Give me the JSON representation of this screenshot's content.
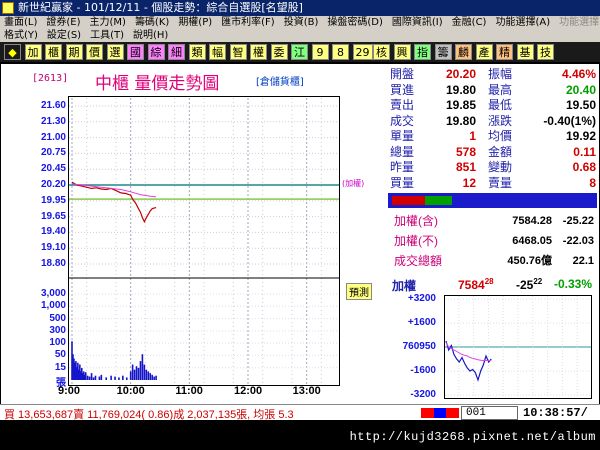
{
  "window": {
    "title": "新世紀贏家 - 101/12/11 - 個股走勢：綜合自選股[名望股]"
  },
  "menu": {
    "row1": [
      "畫面(L)",
      "證券(E)",
      "主力(M)",
      "籌碼(K)",
      "期權(P)",
      "匯市利率(F)",
      "投資(B)",
      "操盤密碼(D)",
      "國際資訊(I)",
      "金融(C)",
      "功能選擇(A)",
      "功能選擇(E)"
    ],
    "row1_disabled_index": 11,
    "row2": [
      "格式(Y)",
      "設定(S)",
      "工具(T)",
      "說明(H)"
    ]
  },
  "toolbar": {
    "items": [
      {
        "label": "◆",
        "bg": "#1a1a1a",
        "fg": "#ff0"
      },
      {
        "label": "加",
        "bg": "#ffff80",
        "fg": "#000"
      },
      {
        "label": "櫃",
        "bg": "#ffff80",
        "fg": "#000"
      },
      {
        "label": "期",
        "bg": "#ffff80",
        "fg": "#000"
      },
      {
        "label": "價",
        "bg": "#ffff80",
        "fg": "#000"
      },
      {
        "label": "選",
        "bg": "#ffff80",
        "fg": "#000"
      },
      {
        "label": "國",
        "bg": "#ff80ff",
        "fg": "#000"
      },
      {
        "label": "綜",
        "bg": "#ff80ff",
        "fg": "#000"
      },
      {
        "label": "細",
        "bg": "#ff80ff",
        "fg": "#000"
      },
      {
        "label": "類",
        "bg": "#ffff80",
        "fg": "#000"
      },
      {
        "label": "幅",
        "bg": "#ffff80",
        "fg": "#000"
      },
      {
        "label": "智",
        "bg": "#ffff80",
        "fg": "#000"
      },
      {
        "label": "權",
        "bg": "#ffff80",
        "fg": "#000"
      },
      {
        "label": "委",
        "bg": "#ffff80",
        "fg": "#000"
      },
      {
        "label": "江",
        "bg": "#80ff80",
        "fg": "#000"
      },
      {
        "label": "9",
        "bg": "#ffff80",
        "fg": "#000"
      },
      {
        "label": "8",
        "bg": "#ffff80",
        "fg": "#000"
      },
      {
        "label": "29",
        "bg": "#ffff80",
        "fg": "#000"
      },
      {
        "label": "核",
        "bg": "#ffff80",
        "fg": "#000"
      },
      {
        "label": "興",
        "bg": "#ffff80",
        "fg": "#000"
      },
      {
        "label": "指",
        "bg": "#80ff80",
        "fg": "#000"
      },
      {
        "label": "籌",
        "bg": "#c0c0c0",
        "fg": "#000"
      },
      {
        "label": "麟",
        "bg": "#ffc080",
        "fg": "#000"
      },
      {
        "label": "產",
        "bg": "#ffff80",
        "fg": "#000"
      },
      {
        "label": "精",
        "bg": "#ffc080",
        "fg": "#000"
      },
      {
        "label": "基",
        "bg": "#ffff80",
        "fg": "#000"
      },
      {
        "label": "技",
        "bg": "#ffff80",
        "fg": "#000"
      }
    ]
  },
  "chart_header": {
    "code": "[2613]",
    "title": "中櫃  量價走勢圖",
    "tag": "[倉儲貨櫃]"
  },
  "chart_labels": {
    "ref_note": "(加權)",
    "presale": "預測"
  },
  "chart_data": {
    "type": "line",
    "price_ticks": [
      "21.60",
      "21.30",
      "21.00",
      "20.75",
      "20.45",
      "20.20",
      "19.95",
      "19.65",
      "19.40",
      "19.10",
      "18.80"
    ],
    "volume_ticks": [
      "3,000",
      "1,000",
      "500",
      "300",
      "100",
      "50",
      "15",
      "張"
    ],
    "x_ticks": [
      "9:00",
      "10:00",
      "11:00",
      "12:00",
      "13:00"
    ],
    "ylim": [
      18.8,
      21.6
    ],
    "reference_price": 20.2,
    "limit_guides": [
      20.2,
      19.95
    ],
    "x_range_minutes": [
      0,
      270
    ],
    "price_series": {
      "name": "成交",
      "x": [
        0,
        5,
        10,
        15,
        20,
        25,
        30,
        35,
        40,
        45,
        50,
        55,
        60,
        62,
        65,
        68,
        70,
        72,
        74,
        76,
        78,
        80,
        82,
        84,
        86
      ],
      "y": [
        20.25,
        20.2,
        20.18,
        20.16,
        20.14,
        20.15,
        20.13,
        20.12,
        20.14,
        20.1,
        20.06,
        20.05,
        20.02,
        19.95,
        19.88,
        19.78,
        19.72,
        19.62,
        19.55,
        19.62,
        19.68,
        19.74,
        19.78,
        19.79,
        19.8
      ]
    },
    "avg_series": {
      "name": "均價",
      "x": [
        0,
        10,
        20,
        30,
        40,
        50,
        60,
        70,
        80,
        86
      ],
      "y": [
        20.22,
        20.2,
        20.18,
        20.16,
        20.14,
        20.12,
        20.08,
        20.03,
        20.0,
        19.99
      ]
    },
    "volume_bars": {
      "x": [
        0,
        1,
        2,
        3,
        4,
        5,
        6,
        7,
        8,
        9,
        10,
        11,
        12,
        13,
        14,
        16,
        18,
        20,
        22,
        24,
        28,
        30,
        35,
        40,
        44,
        48,
        52,
        56,
        60,
        62,
        64,
        66,
        68,
        70,
        72,
        74,
        76,
        78,
        80,
        82,
        84,
        86
      ],
      "level": [
        0.45,
        0.3,
        0.25,
        0.2,
        0.22,
        0.15,
        0.2,
        0.12,
        0.18,
        0.1,
        0.14,
        0.08,
        0.1,
        0.06,
        0.09,
        0.05,
        0.04,
        0.08,
        0.03,
        0.05,
        0.04,
        0.06,
        0.03,
        0.05,
        0.04,
        0.03,
        0.05,
        0.03,
        0.1,
        0.18,
        0.12,
        0.16,
        0.14,
        0.22,
        0.3,
        0.18,
        0.12,
        0.1,
        0.08,
        0.06,
        0.04,
        0.05
      ]
    },
    "grid": true
  },
  "quote": {
    "rows": [
      {
        "l1": "開盤",
        "v1": "20.20",
        "v1c": "#d00000",
        "l2": "振幅",
        "v2": "4.46%",
        "v2c": "#d00000"
      },
      {
        "l1": "買進",
        "v1": "19.80",
        "v1c": "#000000",
        "l2": "最高",
        "v2": "20.40",
        "v2c": "#00a000"
      },
      {
        "l1": "賣出",
        "v1": "19.85",
        "v1c": "#000000",
        "l2": "最低",
        "v2": "19.50",
        "v2c": "#000000"
      },
      {
        "l1": "成交",
        "v1": "19.80",
        "v1c": "#000000",
        "l2": "漲跌",
        "v2": "-0.40(1%)",
        "v2c": "#000000"
      },
      {
        "l1": "單量",
        "v1": "1",
        "v1c": "#d00000",
        "l2": "均價",
        "v2": "19.92",
        "v2c": "#000000"
      },
      {
        "l1": "總量",
        "v1": "578",
        "v1c": "#d00000",
        "l2": "金額",
        "v2": "0.11",
        "v2c": "#d00000"
      },
      {
        "l1": "昨量",
        "v1": "851",
        "v1c": "#d00000",
        "l2": "變動",
        "v2": "0.68",
        "v2c": "#d00000"
      },
      {
        "l1": "買量",
        "v1": "12",
        "v1c": "#d00000",
        "l2": "賣量",
        "v2": "8",
        "v2c": "#d00000"
      }
    ],
    "bar": [
      {
        "color": "#d00000",
        "share": 0.55
      },
      {
        "color": "#00a000",
        "share": 0.45
      }
    ]
  },
  "index_panel": {
    "rows": [
      {
        "label": "加權(含)",
        "value": "7584.28",
        "change": "-25.22"
      },
      {
        "label": "加權(不)",
        "value": "6468.05",
        "change": "-22.03"
      },
      {
        "label": "成交總額",
        "value": "450.76億",
        "change": "22.1"
      }
    ]
  },
  "mini_chart": {
    "label": "加權",
    "label_color": "#2222aa",
    "value": "7584",
    "value_sup": "28",
    "value_color": "#d00000",
    "change": "-25",
    "change_sup": "22",
    "change_color": "#000000",
    "pct": "-0.33%",
    "pct_color": "#00a000",
    "y_ticks": [
      "+3200",
      "+1600",
      "760950",
      "-1600",
      "-3200"
    ],
    "series_x": [
      0,
      5,
      10,
      15,
      20,
      25,
      30,
      35,
      40,
      45,
      50,
      55,
      60,
      65,
      70,
      75,
      80,
      85
    ],
    "series_y": [
      0.4,
      -0.2,
      0.1,
      -0.5,
      -0.8,
      -1.0,
      -0.7,
      -1.1,
      -1.4,
      -1.6,
      -1.5,
      -1.7,
      -2.2,
      -1.6,
      -1.2,
      -0.6,
      -1.0,
      -0.8
    ],
    "avg_y": [
      0.3,
      0.0,
      -0.1,
      -0.2,
      -0.3,
      -0.4,
      -0.5,
      -0.55,
      -0.6,
      -0.7,
      -0.75,
      -0.8,
      -0.85,
      -0.88,
      -0.9,
      -0.9,
      -0.9,
      -0.9
    ]
  },
  "status": {
    "text": "買 13,653,687賣 11,769,024( 0.86)成 2,037,135張, 均張 5.3",
    "strip": [
      {
        "color": "#ff0000",
        "share": 0.35
      },
      {
        "color": "#0000ff",
        "share": 0.3
      },
      {
        "color": "#ff0000",
        "share": 0.35
      }
    ],
    "page": "001",
    "clock": "10:38:57/"
  },
  "footer": {
    "url": "http://kujd3268.pixnet.net/album"
  }
}
